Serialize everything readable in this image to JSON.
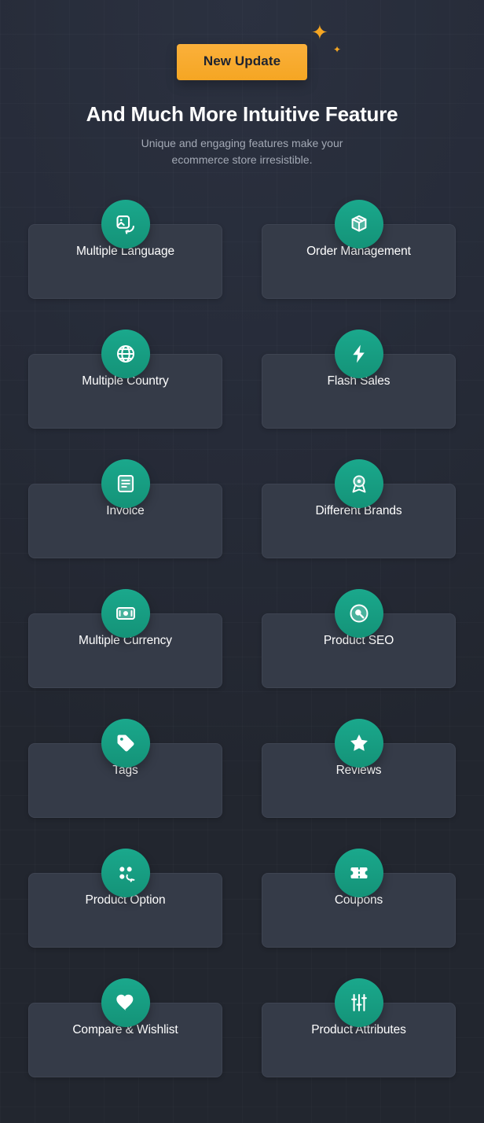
{
  "badge": {
    "label": "New Update"
  },
  "header": {
    "title": "And Much More Intuitive Feature",
    "subtitle_line1": "Unique and engaging features make your",
    "subtitle_line2": "ecommerce store irresistible."
  },
  "decor": {
    "sparkle_large": "✦",
    "sparkle_small": "✦"
  },
  "colors": {
    "page_bg": "#262b38",
    "card_bg": "#353b48",
    "card_border": "#3e4452",
    "accent": "#17a085",
    "badge": "#f5a623",
    "text": "#ffffff",
    "muted_text": "#a3a9b5"
  },
  "features": [
    {
      "label": "Multiple Language",
      "icon": "image-language-icon"
    },
    {
      "label": "Order Management",
      "icon": "box-package-icon"
    },
    {
      "label": "Multiple Country",
      "icon": "globe-icon"
    },
    {
      "label": "Flash Sales",
      "icon": "lightning-bolt-icon"
    },
    {
      "label": "Invoice",
      "icon": "invoice-document-icon"
    },
    {
      "label": "Different Brands",
      "icon": "award-badge-icon"
    },
    {
      "label": "Multiple Currency",
      "icon": "banknote-currency-icon"
    },
    {
      "label": "Product SEO",
      "icon": "magnifier-circle-icon"
    },
    {
      "label": "Tags",
      "icon": "tag-icon"
    },
    {
      "label": "Reviews",
      "icon": "star-icon"
    },
    {
      "label": "Product Option",
      "icon": "options-dots-icon"
    },
    {
      "label": "Coupons",
      "icon": "ticket-coupon-icon"
    },
    {
      "label": "Compare & Wishlist",
      "icon": "heart-icon"
    },
    {
      "label": "Product Attributes",
      "icon": "sliders-icon"
    }
  ]
}
